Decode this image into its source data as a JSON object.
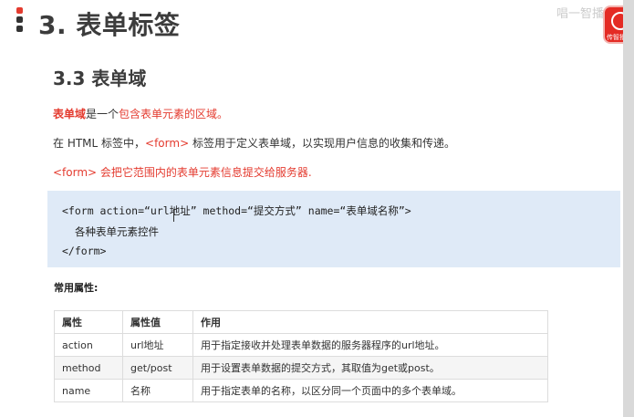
{
  "header": {
    "section_title": "3. 表单标签",
    "logo_text": "唱一智播客",
    "badge_label": "传智播"
  },
  "sub_title": "3.3 表单域",
  "intro": {
    "term": "表单域",
    "text_mid": "是一个",
    "text_red": "包含表单元素的区域。"
  },
  "para2": {
    "prefix": "在 HTML 标签中，",
    "tag": "<form>",
    "suffix": " 标签用于定义表单域，以实现用户信息的收集和传递。"
  },
  "para3": "<form> 会把它范围内的表单元素信息提交给服务器.",
  "code": {
    "line1": "<form action=“url地址” method=“提交方式” name=“表单域名称”>",
    "line2": "各种表单元素控件",
    "line3": "</form>"
  },
  "attr_heading": "常用属性:",
  "table": {
    "headers": [
      "属性",
      "属性值",
      "作用"
    ],
    "rows": [
      [
        "action",
        "url地址",
        "用于指定接收并处理表单数据的服务器程序的url地址。"
      ],
      [
        "method",
        "get/post",
        "用于设置表单数据的提交方式，其取值为get或post。"
      ],
      [
        "name",
        "名称",
        "用于指定表单的名称，以区分同一个页面中的多个表单域。"
      ]
    ]
  },
  "colors": {
    "accent": "#e43b2f",
    "code_bg": "#dfeaf7"
  }
}
